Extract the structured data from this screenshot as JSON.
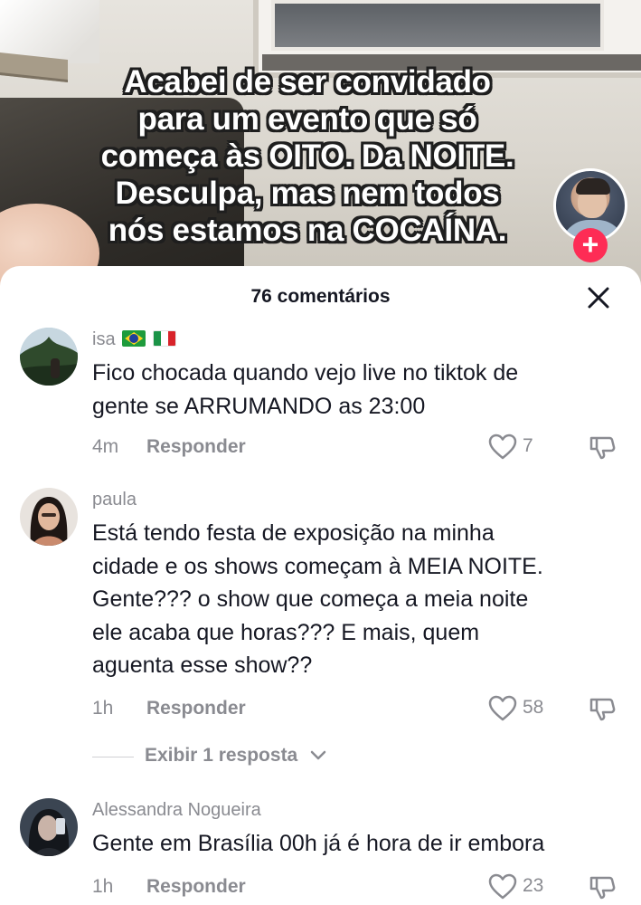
{
  "video": {
    "overlay_lines": [
      "Acabei de ser convidado",
      "para um evento que só",
      "começa às OITO. Da NOITE.",
      "Desculpa, mas nem todos",
      "nós estamos na COCAÍNA."
    ],
    "follow_symbol": "+"
  },
  "comments_panel": {
    "title": "76 comentários",
    "reply_label": "Responder",
    "comments": [
      {
        "username": "isa",
        "flags": [
          "brazil-flag",
          "italy-flag"
        ],
        "text_lines": [
          "Fico chocada quando vejo live no tiktok de",
          "gente se ARRUMANDO as 23:00"
        ],
        "time": "4m",
        "likes": "7"
      },
      {
        "username": "paula",
        "text_lines": [
          "Está tendo festa de exposição na minha",
          "cidade e os shows começam à MEIA NOITE.",
          "Gente??? o show que começa a meia noite",
          "ele acaba que horas??? E mais, quem",
          "aguenta esse show??"
        ],
        "time": "1h",
        "likes": "58",
        "view_replies": "Exibir 1 resposta"
      },
      {
        "username": "Alessandra Nogueira",
        "text_lines": [
          "Gente em Brasília 00h já é hora de ir embora"
        ],
        "time": "1h",
        "likes": "23"
      }
    ]
  },
  "colors": {
    "accent": "#fe2c55",
    "text_primary": "#161823",
    "text_secondary": "#8a8b91"
  }
}
